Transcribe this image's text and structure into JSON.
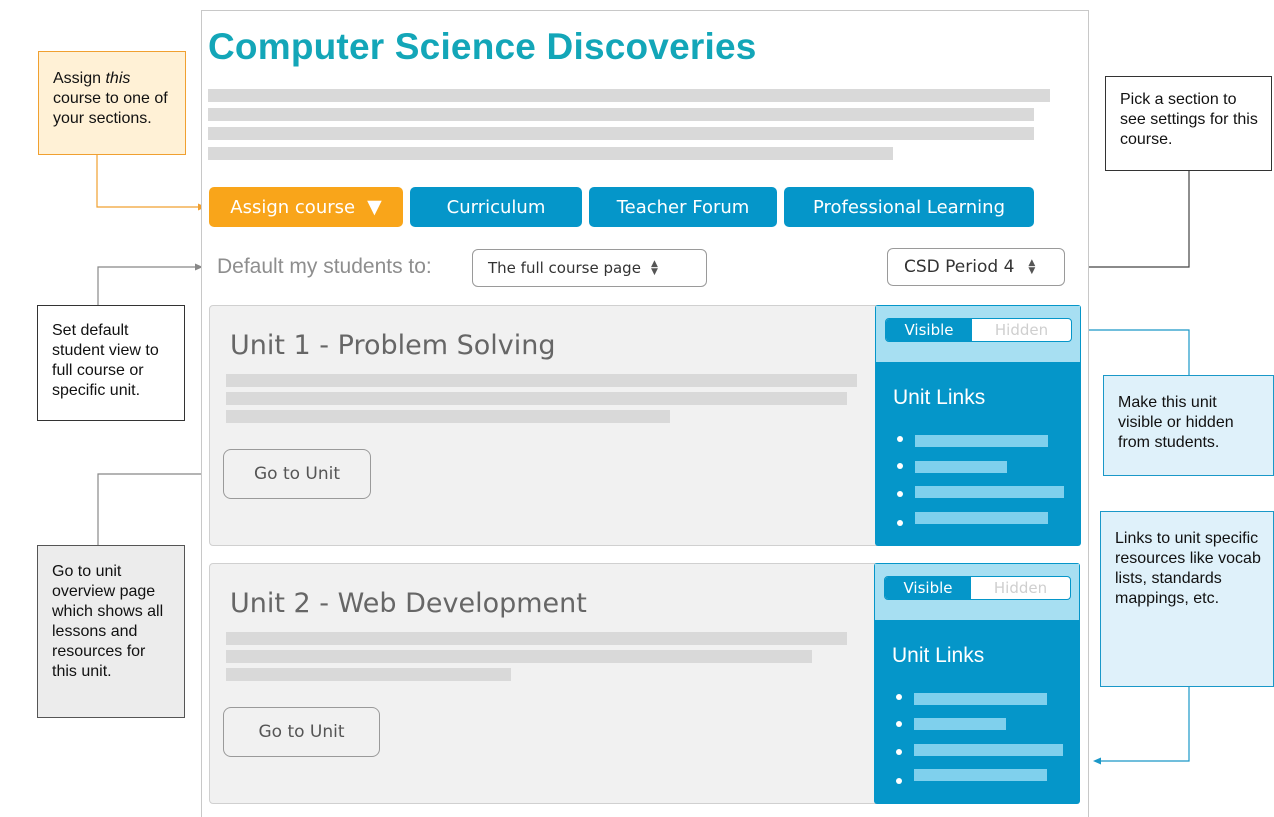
{
  "page": {
    "title": "Computer Science Discoveries"
  },
  "toolbar": {
    "assign_label": "Assign course",
    "assign_caret": "▼",
    "curriculum_label": "Curriculum",
    "forum_label": "Teacher Forum",
    "learning_label": "Professional Learning"
  },
  "defaults": {
    "label": "Default my students to:",
    "student_view_value": "The full course page",
    "section_value": "CSD Period 4"
  },
  "units": [
    {
      "title": "Unit 1 - Problem Solving",
      "go_label": "Go to Unit",
      "toggle_visible": "Visible",
      "toggle_hidden": "Hidden",
      "visibility": "visible",
      "links_title": "Unit Links"
    },
    {
      "title": "Unit 2 - Web Development",
      "go_label": "Go to Unit",
      "toggle_visible": "Visible",
      "toggle_hidden": "Hidden",
      "visibility": "visible",
      "links_title": "Unit Links"
    }
  ],
  "annotations": {
    "assign_line1_pre": "Assign ",
    "assign_line1_em": "this",
    "assign_rest": "course to one of your sections.",
    "pick_section": "Pick a section to see settings for this course.",
    "default_view": "Set default student view to full course or specific unit.",
    "visibility": "Make this unit visible or hidden from students.",
    "go_to_unit": "Go to unit overview page which shows all lessons and resources for this unit.",
    "unit_links": "Links to unit specific resources like vocab lists, standards mappings, etc."
  },
  "colors": {
    "title_teal": "#13a6b8",
    "assign_orange": "#f9a51a",
    "primary_blue": "#0596c9",
    "toggle_band": "#a7dff2",
    "placeholder_gray": "#d9d9d9",
    "link_bar": "#7fd0ed",
    "note_orange": "#fff1d6",
    "note_blue": "#dff1fa",
    "note_gray": "#ececec"
  },
  "icons": {
    "select_arrows": "updown-arrows-icon",
    "dropdown_caret": "caret-down-icon"
  }
}
